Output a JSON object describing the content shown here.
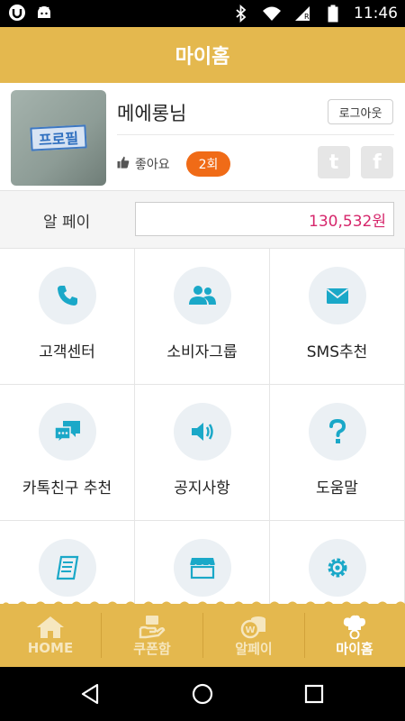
{
  "status_bar": {
    "time": "11:46",
    "icons": [
      "u-app-icon",
      "android-icon",
      "bluetooth-icon",
      "wifi-icon",
      "signal-icon",
      "battery-icon"
    ]
  },
  "header": {
    "title": "마이홈"
  },
  "profile": {
    "avatar_text": "프로필",
    "nickname": "메에롱님",
    "logout_label": "로그아웃",
    "like_label": "좋아요",
    "like_count": "2회",
    "sns": {
      "twitter": "t",
      "facebook": "f"
    }
  },
  "pay": {
    "label": "알 페이",
    "value": "130,532원"
  },
  "menu": [
    {
      "label": "고객센터",
      "icon": "phone-icon"
    },
    {
      "label": "소비자그룹",
      "icon": "group-icon"
    },
    {
      "label": "SMS추천",
      "icon": "mail-icon"
    },
    {
      "label": "카톡친구 추천",
      "icon": "chat-icon"
    },
    {
      "label": "공지사항",
      "icon": "speaker-icon"
    },
    {
      "label": "도움말",
      "icon": "question-icon"
    },
    {
      "label": "",
      "icon": "document-icon"
    },
    {
      "label": "",
      "icon": "store-icon"
    },
    {
      "label": "",
      "icon": "settings-icon"
    }
  ],
  "tabs": [
    {
      "label": "HOME",
      "icon": "home-icon"
    },
    {
      "label": "쿠폰함",
      "icon": "coupon-icon"
    },
    {
      "label": "알페이",
      "icon": "coins-icon"
    },
    {
      "label": "마이홈",
      "icon": "chef-icon",
      "active": true
    }
  ],
  "colors": {
    "accent": "#e4b84e",
    "icon": "#1aa8c8",
    "badge": "#f06b17",
    "pay_value": "#d6266b"
  }
}
